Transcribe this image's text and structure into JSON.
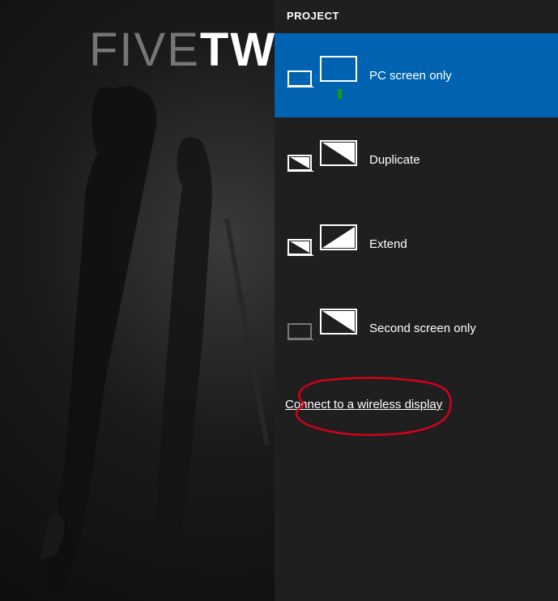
{
  "desktop": {
    "wallpaper_text_thin": "FIVE",
    "wallpaper_text_bold": "TWI"
  },
  "panel": {
    "title": "PROJECT",
    "options": [
      {
        "label": "PC screen only",
        "selected": true
      },
      {
        "label": "Duplicate",
        "selected": false
      },
      {
        "label": "Extend",
        "selected": false
      },
      {
        "label": "Second screen only",
        "selected": false
      }
    ],
    "wireless_link": "Connect to a wireless display"
  },
  "colors": {
    "panel_bg": "#1f1f1f",
    "selected_bg": "#0063b1",
    "annotation": "#d4001a"
  }
}
